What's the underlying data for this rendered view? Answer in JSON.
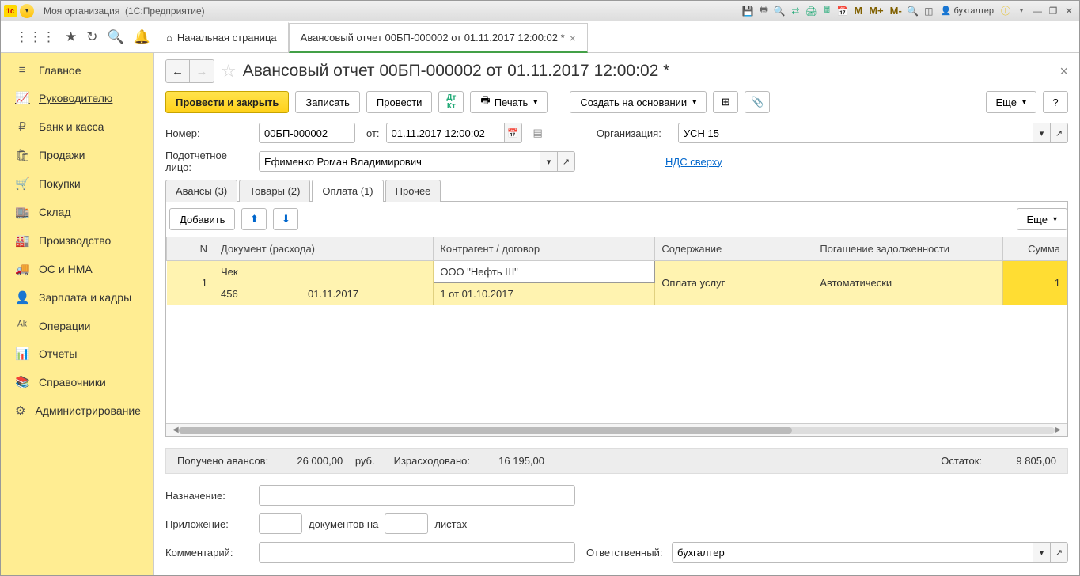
{
  "titlebar": {
    "org": "Моя организация",
    "product": "(1С:Предприятие)",
    "user": "бухгалтер",
    "m_labels": [
      "M",
      "M+",
      "M-"
    ]
  },
  "app_tabs": {
    "home": "Начальная страница",
    "active": "Авансовый отчет 00БП-000002 от 01.11.2017 12:00:02 *"
  },
  "sidebar": {
    "items": [
      {
        "icon": "≡",
        "label": "Главное"
      },
      {
        "icon": "📈",
        "label": "Руководителю"
      },
      {
        "icon": "₽",
        "label": "Банк и касса"
      },
      {
        "icon": "🛍",
        "label": "Продажи"
      },
      {
        "icon": "🛒",
        "label": "Покупки"
      },
      {
        "icon": "🏬",
        "label": "Склад"
      },
      {
        "icon": "🏭",
        "label": "Производство"
      },
      {
        "icon": "🚚",
        "label": "ОС и НМА"
      },
      {
        "icon": "👤",
        "label": "Зарплата и кадры"
      },
      {
        "icon": "ᴬᵏ",
        "label": "Операции"
      },
      {
        "icon": "📊",
        "label": "Отчеты"
      },
      {
        "icon": "📚",
        "label": "Справочники"
      },
      {
        "icon": "⚙",
        "label": "Администрирование"
      }
    ],
    "active_index": 1
  },
  "doc": {
    "title": "Авансовый отчет 00БП-000002 от 01.11.2017 12:00:02 *",
    "buttons": {
      "post_close": "Провести и закрыть",
      "write": "Записать",
      "post": "Провести",
      "print": "Печать",
      "create_based": "Создать на основании",
      "more": "Еще"
    },
    "fields": {
      "number_label": "Номер:",
      "number": "00БП-000002",
      "from_label": "от:",
      "date": "01.11.2017 12:00:02",
      "org_label": "Организация:",
      "org": "УСН 15",
      "person_label": "Подотчетное лицо:",
      "person": "Ефименко Роман Владимирович",
      "nds_link": "НДС сверху"
    },
    "subtabs": [
      {
        "label": "Авансы (3)"
      },
      {
        "label": "Товары (2)"
      },
      {
        "label": "Оплата (1)"
      },
      {
        "label": "Прочее"
      }
    ],
    "active_subtab": 2,
    "table_toolbar": {
      "add": "Добавить",
      "more": "Еще"
    },
    "table": {
      "headers": {
        "n": "N",
        "doc": "Документ (расхода)",
        "counterparty": "Контрагент / договор",
        "content": "Содержание",
        "repayment": "Погашение задолженности",
        "sum": "Сумма"
      },
      "rows": [
        {
          "n": "1",
          "doc_type": "Чек",
          "doc_num": "456",
          "doc_date": "01.11.2017",
          "counterparty": "ООО \"Нефть Ш\"",
          "contract": "1 от 01.10.2017",
          "content": "Оплата услуг",
          "repayment": "Автоматически",
          "sum": "1"
        }
      ]
    },
    "summary": {
      "received_label": "Получено авансов:",
      "received": "26 000,00",
      "currency": "руб.",
      "spent_label": "Израсходовано:",
      "spent": "16 195,00",
      "balance_label": "Остаток:",
      "balance": "9 805,00"
    },
    "bottom": {
      "purpose_label": "Назначение:",
      "purpose": "",
      "attachment_label": "Приложение:",
      "attach_docs": "",
      "docs_text": "документов на",
      "attach_sheets": "",
      "sheets_text": "листах",
      "comment_label": "Комментарий:",
      "comment": "",
      "responsible_label": "Ответственный:",
      "responsible": "бухгалтер"
    }
  }
}
